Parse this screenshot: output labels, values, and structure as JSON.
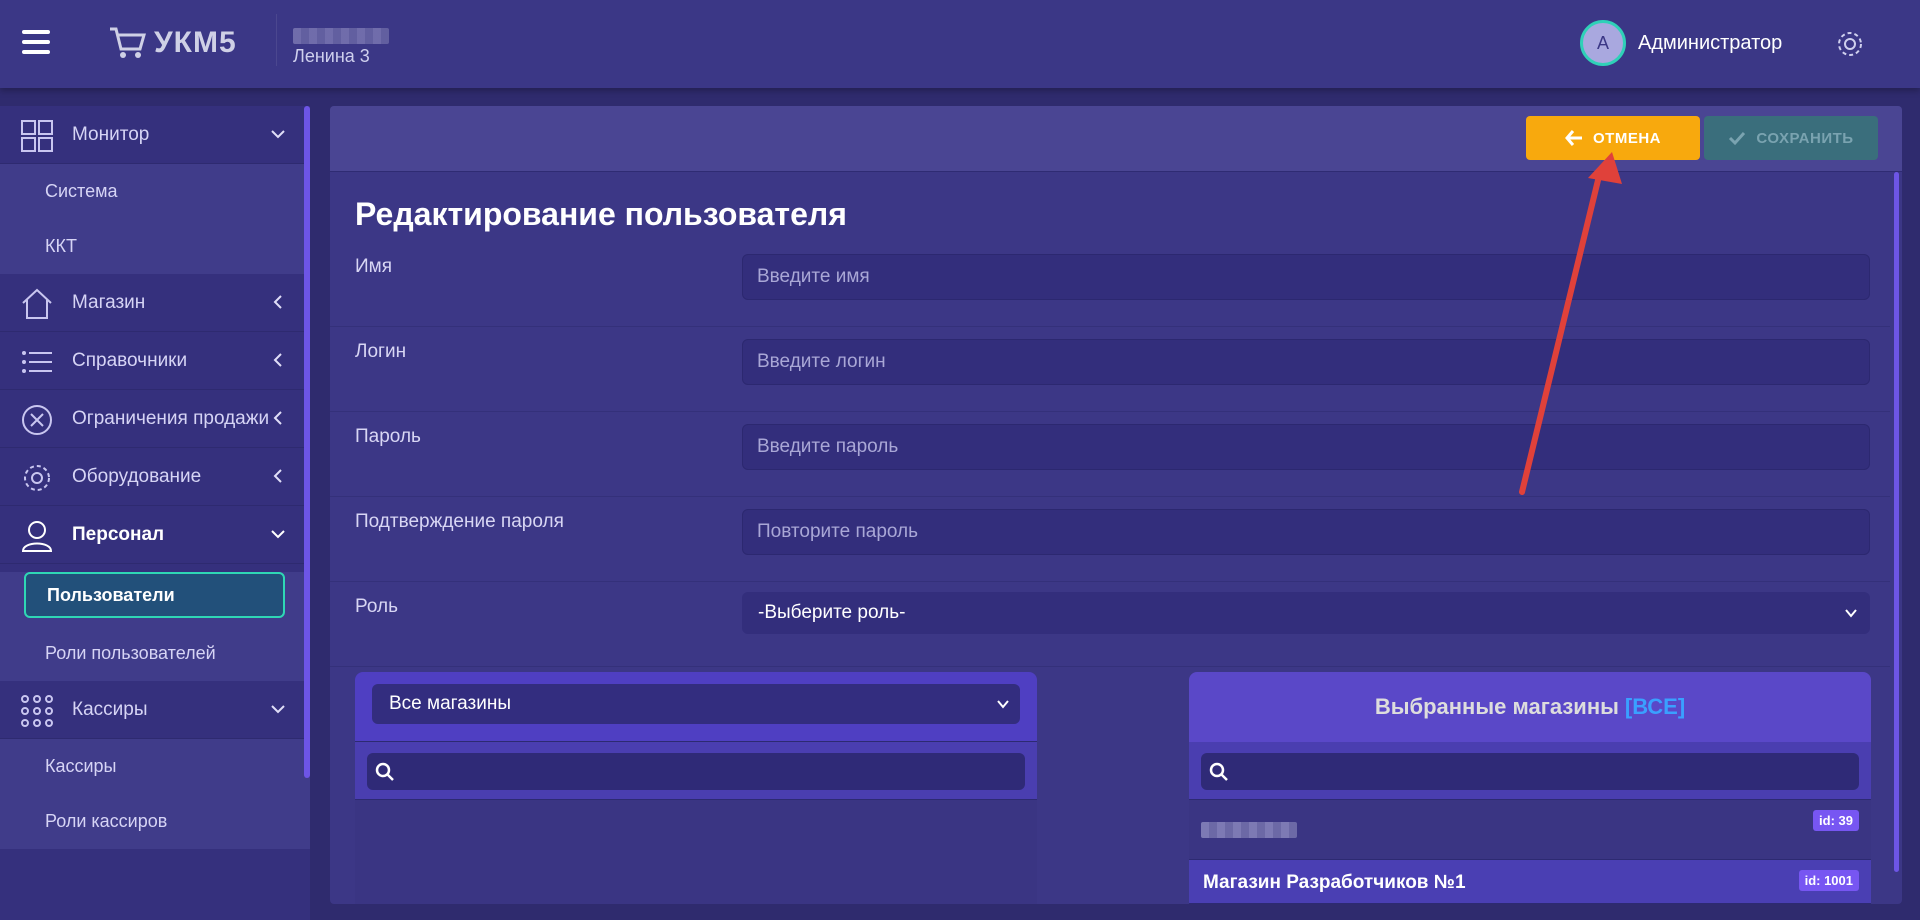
{
  "header": {
    "logo_text": "УКМ5",
    "store_name": "Ленина 3",
    "user_initial": "А",
    "user_name": "Администратор"
  },
  "sidebar": {
    "groups": [
      {
        "label": "Монитор",
        "icon": "grid-icon",
        "expanded": true,
        "items": [
          {
            "label": "Система"
          },
          {
            "label": "ККТ"
          }
        ]
      },
      {
        "label": "Магазин",
        "icon": "home-icon",
        "expanded": false
      },
      {
        "label": "Справочники",
        "icon": "list-icon",
        "expanded": false
      },
      {
        "label": "Ограничения продажи",
        "icon": "cross-circle-icon",
        "expanded": false
      },
      {
        "label": "Оборудование",
        "icon": "gear-icon",
        "expanded": false
      },
      {
        "label": "Персонал",
        "icon": "user-icon",
        "expanded": true,
        "items": [
          {
            "label": "Пользователи",
            "selected": true
          },
          {
            "label": "Роли пользователей"
          }
        ]
      },
      {
        "label": "Кассиры",
        "icon": "dots-grid-icon",
        "expanded": true,
        "items": [
          {
            "label": "Кассиры"
          },
          {
            "label": "Роли кассиров"
          }
        ]
      }
    ]
  },
  "toolbar": {
    "cancel_label": "ОТМЕНА",
    "save_label": "СОХРАНИТЬ"
  },
  "form": {
    "title": "Редактирование пользователя",
    "fields": [
      {
        "label": "Имя",
        "placeholder": "Введите имя"
      },
      {
        "label": "Логин",
        "placeholder": "Введите логин"
      },
      {
        "label": "Пароль",
        "placeholder": "Введите пароль"
      },
      {
        "label": "Подтверждение пароля",
        "placeholder": "Повторите пароль"
      }
    ],
    "role_label": "Роль",
    "role_value": "-Выберите роль-"
  },
  "stores": {
    "left_select": "Все магазины",
    "right_title": "Выбранные магазины",
    "right_all": "[ВСЕ]",
    "selected": [
      {
        "name": "",
        "id": "id: 39"
      },
      {
        "name": "Магазин Разработчиков №1",
        "id": "id: 1001"
      }
    ]
  },
  "colors": {
    "accent": "#f8a90d",
    "save_disabled": "#3a6e7c",
    "selection_border": "#2fd7b5",
    "badge": "#7756f2"
  }
}
